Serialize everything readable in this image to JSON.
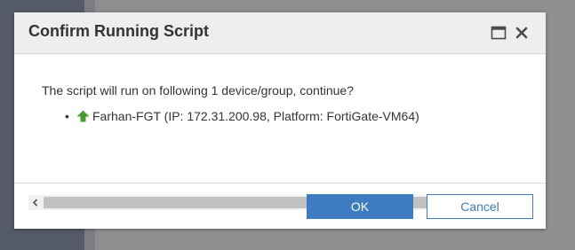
{
  "dialog": {
    "title": "Confirm Running Script",
    "message": "The script will run on following 1 device/group, continue?",
    "devices": [
      {
        "status_icon": "up-arrow-icon",
        "status_color": "#4b9b35",
        "label": "Farhan-FGT (IP: 172.31.200.98, Platform: FortiGate-VM64)"
      }
    ],
    "ok_label": "OK",
    "cancel_label": "Cancel",
    "window_controls": {
      "maximize_icon": "maximize-icon",
      "close_icon": "close-icon"
    }
  },
  "colors": {
    "primary": "#3e7cc1",
    "header_bg": "#eeeeee",
    "backdrop": "#8f8f8f",
    "side_panel": "#545b66"
  }
}
